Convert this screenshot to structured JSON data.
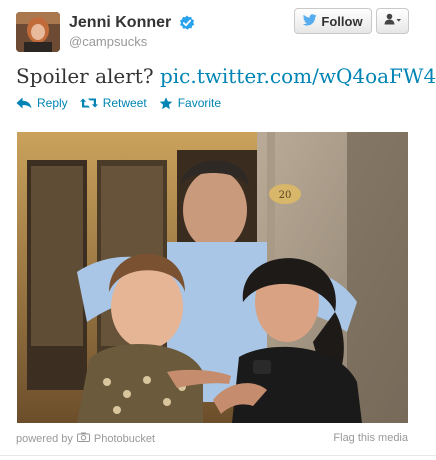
{
  "author": {
    "name": "Jenni Konner",
    "handle": "@campsucks",
    "verified": true
  },
  "header": {
    "follow_label": "Follow",
    "menu_icon": "person-icon"
  },
  "tweet": {
    "text": "Spoiler alert?",
    "link": "pic.twitter.com/wQ4oaFW4"
  },
  "actions": {
    "reply_label": "Reply",
    "retweet_label": "Retweet",
    "favorite_label": "Favorite"
  },
  "media": {
    "building_number": "20"
  },
  "footer": {
    "powered_prefix": "powered by",
    "powered_brand": "Photobucket",
    "flag_label": "Flag this media"
  },
  "colors": {
    "link": "#0084b4",
    "verified": "#2aa3ef",
    "twitter_bird": "#55acee"
  }
}
